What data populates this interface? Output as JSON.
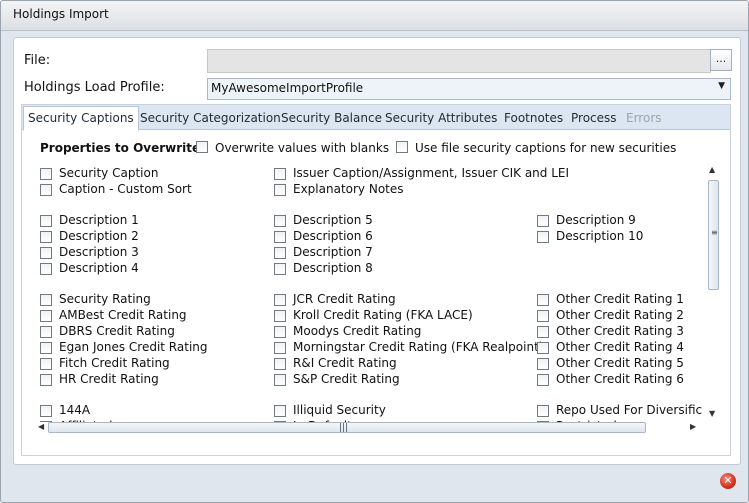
{
  "window": {
    "title": "Holdings Import"
  },
  "form": {
    "file_label": "File:",
    "file_value": "",
    "browse_label": "...",
    "profile_label": "Holdings Load Profile:",
    "profile_value": "MyAwesomeImportProfile"
  },
  "tabs": [
    {
      "label": "Security Captions",
      "active": true,
      "enabled": true
    },
    {
      "label": "Security Categorization",
      "active": false,
      "enabled": true
    },
    {
      "label": "Security Balance",
      "active": false,
      "enabled": true
    },
    {
      "label": "Security Attributes",
      "active": false,
      "enabled": true
    },
    {
      "label": "Footnotes",
      "active": false,
      "enabled": true
    },
    {
      "label": "Process",
      "active": false,
      "enabled": true
    },
    {
      "label": "Errors",
      "active": false,
      "enabled": false
    }
  ],
  "captions": {
    "header": "Properties to Overwrite",
    "overwrite_blanks_label": "Overwrite values with blanks",
    "overwrite_blanks_checked": false,
    "use_file_captions_label": "Use file security captions for new securities",
    "use_file_captions_checked": false,
    "items": [
      [
        "Security Caption",
        "Issuer Caption/Assignment, Issuer CIK and LEI",
        ""
      ],
      [
        "Caption - Custom Sort",
        "Explanatory Notes",
        ""
      ],
      [
        "Description 1",
        "Description 5",
        "Description 9"
      ],
      [
        "Description 2",
        "Description 6",
        "Description 10"
      ],
      [
        "Description 3",
        "Description 7",
        ""
      ],
      [
        "Description 4",
        "Description 8",
        ""
      ],
      [
        "Security Rating",
        "JCR Credit Rating",
        "Other Credit Rating 1"
      ],
      [
        "AMBest Credit Rating",
        "Kroll Credit Rating (FKA LACE)",
        "Other Credit Rating 2"
      ],
      [
        "DBRS Credit Rating",
        "Moodys Credit Rating",
        "Other Credit Rating 3"
      ],
      [
        "Egan Jones Credit Rating",
        "Morningstar Credit Rating (FKA Realpoint)",
        "Other Credit Rating 4"
      ],
      [
        "Fitch Credit Rating",
        "R&I Credit Rating",
        "Other Credit Rating 5"
      ],
      [
        "HR Credit Rating",
        "S&P Credit Rating",
        "Other Credit Rating 6"
      ],
      [
        "144A",
        "Illiquid Security",
        "Repo Used For Diversifica"
      ],
      [
        "Affiliated",
        "In Default",
        "Restricted"
      ]
    ]
  },
  "colors": {
    "accent": "#dce6f0",
    "close": "#d2321e"
  },
  "icons": {
    "close": "close-icon",
    "scroll_up": "scroll-up-arrow-icon",
    "scroll_down": "scroll-down-arrow-icon"
  }
}
